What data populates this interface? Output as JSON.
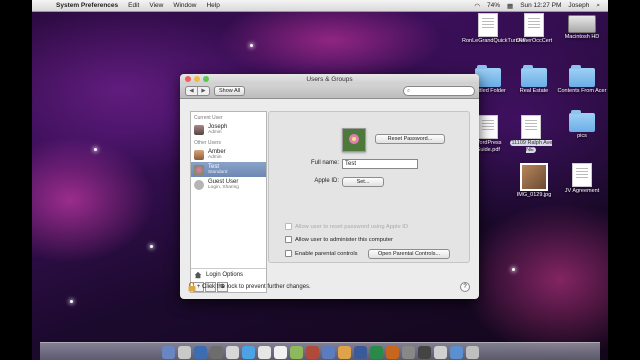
{
  "menubar": {
    "app_name": "System Preferences",
    "menus": [
      "Edit",
      "View",
      "Window",
      "Help"
    ],
    "battery": "74%",
    "clock": "Sun 12:27 PM",
    "user": "Joseph"
  },
  "desktop_icons": [
    {
      "label": "RonLeGrandQuickTurnRE"
    },
    {
      "label": "OwnerOccCert"
    },
    {
      "label": "Macintosh HD"
    },
    {
      "label": "Untitled Folder"
    },
    {
      "label": "Real Estate"
    },
    {
      "label": "Contents From Acer"
    },
    {
      "label": "WordPress Guide.pdf"
    },
    {
      "label": "11109 Ralph Ave NE"
    },
    {
      "label": "pics"
    },
    {
      "label": "IMG_0129.jpg"
    },
    {
      "label": "JV Agreement"
    }
  ],
  "window": {
    "title": "Users & Groups",
    "show_all": "Show All",
    "search_placeholder": "",
    "sidebar": {
      "current_user_header": "Current User",
      "other_users_header": "Other Users",
      "current_user": {
        "name": "Joseph",
        "role": "Admin"
      },
      "other_users": [
        {
          "name": "Amber",
          "role": "Admin"
        },
        {
          "name": "Test",
          "role": "Standard"
        },
        {
          "name": "Guest User",
          "role": "Login, Sharing"
        }
      ],
      "login_options": "Login Options",
      "add_btn": "+",
      "remove_btn": "−",
      "action_btn": "⚙"
    },
    "panel": {
      "reset_password": "Reset Password...",
      "full_name_label": "Full name:",
      "full_name_value": "Test",
      "apple_id_label": "Apple ID:",
      "apple_id_button": "Set...",
      "allow_reset": "Allow user to reset password using Apple ID",
      "allow_admin": "Allow user to administer this computer",
      "enable_parental": "Enable parental controls",
      "open_parental": "Open Parental Controls..."
    },
    "lock_text": "Click the lock to prevent further changes.",
    "help": "?"
  },
  "colors": {
    "selection": "#6d88b4",
    "red": "#ef5e5b",
    "yellow": "#f3b845",
    "green": "#5fc651"
  }
}
